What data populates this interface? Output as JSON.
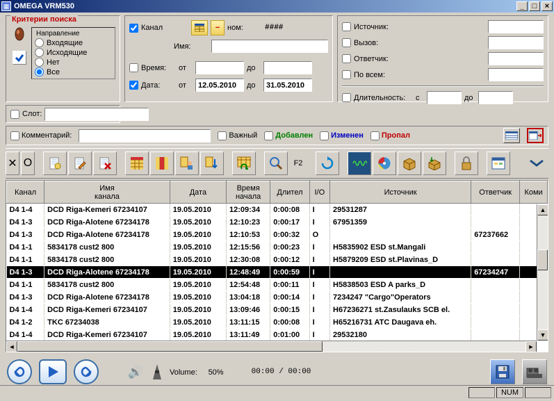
{
  "title": "OMEGA VRM530",
  "criteria": {
    "legend": "Критерии поиска",
    "direction_label": "Направление",
    "options": [
      "Входящие",
      "Исходящие",
      "Нет",
      "Все"
    ],
    "selected": 3
  },
  "mid": {
    "channel_label": "Канал",
    "nom_label": "ном:",
    "nom_value": "####",
    "name_label": "Имя:",
    "time_label": "Время:",
    "date_label": "Дата:",
    "from_label": "от",
    "to_label": "до",
    "date_from": "12.05.2010",
    "date_to": "31.05.2010"
  },
  "right": {
    "source": "Источник:",
    "call": "Вызов:",
    "answer": "Ответчик:",
    "all": "По всем:",
    "duration": "Длительность:",
    "from": "с",
    "to": "до"
  },
  "slot_label": "Слот:",
  "comment_label": "Комментарий:",
  "flags": {
    "important": "Важный",
    "added": "Добавлен",
    "changed": "Изменен",
    "deleted": "Пропал"
  },
  "toolbar_f2": "F2",
  "columns": [
    "Канал",
    "Имя канала",
    "Дата",
    "Время начала",
    "Длител",
    "I/O",
    "Источник",
    "Ответчик",
    "Коми"
  ],
  "rows": [
    {
      "c": "D4 1-4",
      "n": "DCD Riga-Kemeri 67234107",
      "d": "19.05.2010",
      "t": "12:09:34",
      "dur": "0:00:08",
      "io": "I",
      "src": "29531287",
      "ans": "",
      "sel": false
    },
    {
      "c": "D4 1-3",
      "n": "DCD Riga-Alotene 67234178",
      "d": "19.05.2010",
      "t": "12:10:23",
      "dur": "0:00:17",
      "io": "I",
      "src": "67951359",
      "ans": "",
      "sel": false
    },
    {
      "c": "D4 1-3",
      "n": "DCD Riga-Alotene 67234178",
      "d": "19.05.2010",
      "t": "12:10:53",
      "dur": "0:00:32",
      "io": "O",
      "src": "",
      "ans": "67237662",
      "sel": false
    },
    {
      "c": "D4 1-1",
      "n": "5834178 cust2 800",
      "d": "19.05.2010",
      "t": "12:15:56",
      "dur": "0:00:23",
      "io": "I",
      "src": "H5835902 ESD st.Mangali",
      "ans": "",
      "sel": false
    },
    {
      "c": "D4 1-1",
      "n": "5834178 cust2 800",
      "d": "19.05.2010",
      "t": "12:30:08",
      "dur": "0:00:12",
      "io": "I",
      "src": "H5879209 ESD st.Plavinas_D",
      "ans": "",
      "sel": false
    },
    {
      "c": "D4 1-3",
      "n": "DCD Riga-Alotene 67234178",
      "d": "19.05.2010",
      "t": "12:48:49",
      "dur": "0:00:59",
      "io": "I",
      "src": "",
      "ans": "67234247",
      "sel": true
    },
    {
      "c": "D4 1-1",
      "n": "5834178 cust2 800",
      "d": "19.05.2010",
      "t": "12:54:48",
      "dur": "0:00:11",
      "io": "I",
      "src": "H5838503 ESD A parks_D",
      "ans": "",
      "sel": false
    },
    {
      "c": "D4 1-3",
      "n": "DCD Riga-Alotene 67234178",
      "d": "19.05.2010",
      "t": "13:04:18",
      "dur": "0:00:14",
      "io": "I",
      "src": "7234247 \"Cargo\"Operators",
      "ans": "",
      "sel": false
    },
    {
      "c": "D4 1-4",
      "n": "DCD Riga-Kemeri 67234107",
      "d": "19.05.2010",
      "t": "13:09:46",
      "dur": "0:00:15",
      "io": "I",
      "src": "H67236271 st.Zasulauks SCB el.",
      "ans": "",
      "sel": false
    },
    {
      "c": "D4 1-2",
      "n": "TKC 67234038",
      "d": "19.05.2010",
      "t": "13:11:15",
      "dur": "0:00:08",
      "io": "I",
      "src": "H65216731 ATC Daugava eh.",
      "ans": "",
      "sel": false
    },
    {
      "c": "D4 1-4",
      "n": "DCD Riga-Kemeri 67234107",
      "d": "19.05.2010",
      "t": "13:11:49",
      "dur": "0:01:00",
      "io": "I",
      "src": "29532180",
      "ans": "",
      "sel": false
    }
  ],
  "player": {
    "volume_label": "Volume:",
    "volume_value": "50%",
    "time": "00:00 / 00:00"
  },
  "status": {
    "num": "NUM"
  }
}
